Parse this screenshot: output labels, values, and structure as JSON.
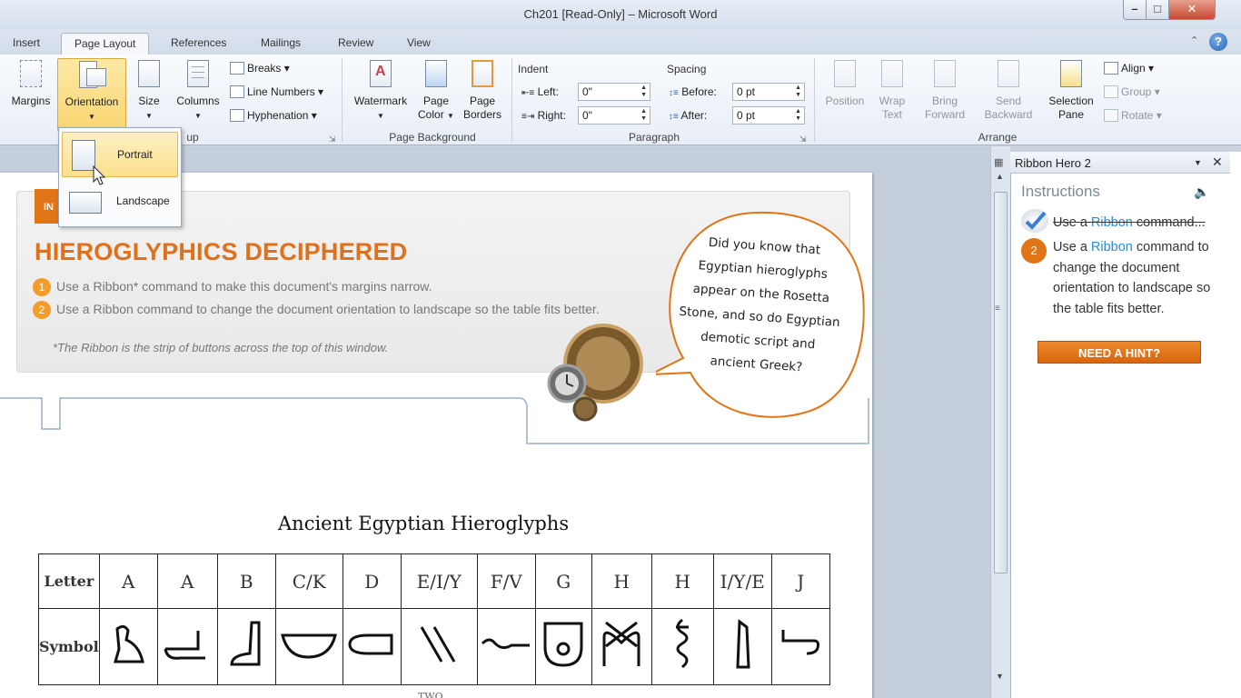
{
  "window": {
    "title": "Ch201 [Read-Only] – Microsoft Word",
    "min": "–",
    "max": "□",
    "close": "✕"
  },
  "tabs": [
    "Insert",
    "Page Layout",
    "References",
    "Mailings",
    "Review",
    "View"
  ],
  "ribbon": {
    "margins": "Margins",
    "orientation": "Orientation",
    "size": "Size",
    "columns": "Columns",
    "breaks": "Breaks",
    "line_numbers": "Line Numbers",
    "hyphenation": "Hyphenation",
    "page_setup_tail": "up",
    "watermark": "Watermark",
    "page_color": [
      "Page",
      "Color"
    ],
    "page_borders": [
      "Page",
      "Borders"
    ],
    "page_background": "Page Background",
    "indent": "Indent",
    "spacing": "Spacing",
    "left_label": "Left:",
    "left_value": "0\"",
    "right_label": "Right:",
    "right_value": "0\"",
    "before_label": "Before:",
    "before_value": "0 pt",
    "after_label": "After:",
    "after_value": "0 pt",
    "paragraph": "Paragraph",
    "position": "Position",
    "wrap_text": [
      "Wrap",
      "Text"
    ],
    "bring_forward": [
      "Bring",
      "Forward"
    ],
    "send_backward": [
      "Send",
      "Backward"
    ],
    "selection_pane": [
      "Selection",
      "Pane"
    ],
    "align": "Align",
    "group": "Group",
    "rotate": "Rotate",
    "arrange": "Arrange"
  },
  "orientation_menu": {
    "portrait": "Portrait",
    "landscape": "Landscape"
  },
  "document": {
    "badge": "IN",
    "heading": "HIEROGLYPHICS DECIPHERED",
    "steps": [
      {
        "num": "1",
        "text": "Use a Ribbon* command to make this document's margins narrow."
      },
      {
        "num": "2",
        "text": "Use a Ribbon command to change the document orientation to landscape so the table fits better."
      }
    ],
    "footnote": "*The Ribbon is the strip of buttons across the top of this window.",
    "bubble_text": "Did you know that Egyptian hieroglyphs appear on the Rosetta Stone, and so do Egyptian demotic script and ancient Greek?",
    "table_title": "Ancient Egyptian Hieroglyphs",
    "row1_header": "Letter",
    "row2_header": "Symbol",
    "letters": [
      "A",
      "A",
      "B",
      "C/K",
      "D",
      "E/I/Y",
      "F/V",
      "G",
      "H",
      "H",
      "I/Y/E",
      "J"
    ],
    "partial_row": "TWO"
  },
  "pane": {
    "title": "Ribbon Hero 2",
    "instructions": "Instructions",
    "step1": {
      "pre": "Use a ",
      "link": "Ribbon",
      "post": " command..."
    },
    "step2": {
      "num": "2",
      "pre": "Use a ",
      "link": "Ribbon",
      "post": " command to change the document orientation to landscape so the table fits better."
    },
    "hint": "NEED A HINT?"
  }
}
